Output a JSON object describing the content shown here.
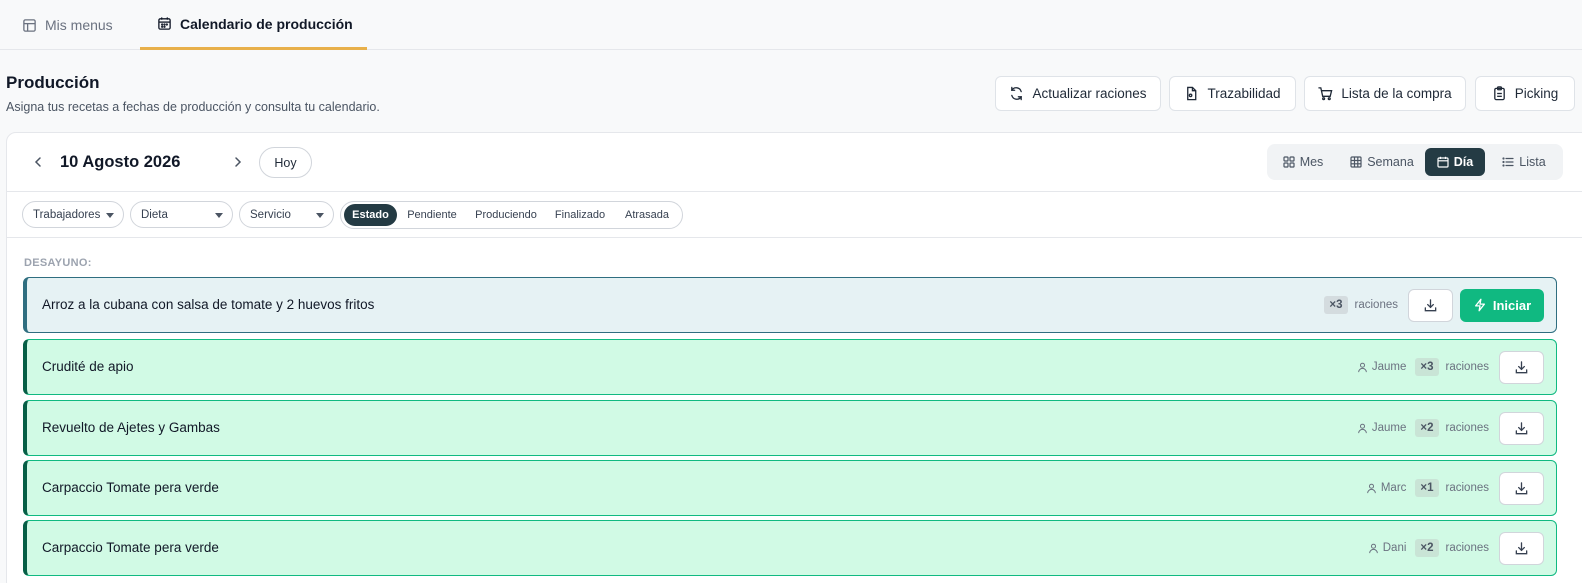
{
  "tabs": [
    {
      "label": "Mis menus",
      "icon": "table-icon"
    },
    {
      "label": "Calendario de producción",
      "icon": "calendar-icon"
    }
  ],
  "page": {
    "title": "Producción",
    "subtitle": "Asigna tus recetas a fechas de producción y consulta tu calendario."
  },
  "actions": [
    {
      "label": "Actualizar raciones",
      "icon": "refresh-icon"
    },
    {
      "label": "Trazabilidad",
      "icon": "document-icon"
    },
    {
      "label": "Lista de la compra",
      "icon": "cart-icon"
    },
    {
      "label": "Picking",
      "icon": "clipboard-icon"
    }
  ],
  "calendar": {
    "date": "10 Agosto 2026",
    "today_label": "Hoy",
    "views": [
      {
        "label": "Mes",
        "icon": "grid-icon"
      },
      {
        "label": "Semana",
        "icon": "table-icon"
      },
      {
        "label": "Día",
        "icon": "calendar-icon",
        "active": true
      },
      {
        "label": "Lista",
        "icon": "list-icon"
      }
    ]
  },
  "filters": {
    "selects": [
      "Trabajadores",
      "Dieta",
      "Servicio"
    ],
    "status": [
      "Estado",
      "Pendiente",
      "Produciendo",
      "Finalizado",
      "Atrasada"
    ],
    "active_status": "Estado"
  },
  "section": {
    "label": "DESAYUNO:",
    "portion_word": "raciones",
    "start_label": "Iniciar",
    "items": [
      {
        "name": "Arroz a la cubana con salsa de tomate y 2 huevos fritos",
        "worker": "",
        "count": "×3",
        "status": "pendiente"
      },
      {
        "name": "Crudité de apio",
        "worker": "Jaume",
        "count": "×3",
        "status": "finalizado"
      },
      {
        "name": "Revuelto de Ajetes y Gambas",
        "worker": "Jaume",
        "count": "×2",
        "status": "finalizado"
      },
      {
        "name": "Carpaccio Tomate pera verde",
        "worker": "Marc",
        "count": "×1",
        "status": "finalizado"
      },
      {
        "name": "Carpaccio Tomate pera verde",
        "worker": "Dani",
        "count": "×2",
        "status": "finalizado"
      }
    ]
  },
  "colors": {
    "accent_tab": "#e8b04a",
    "active_dark": "#243b44",
    "start_green": "#10b981",
    "done_bg": "#d1fae5",
    "pending_bg": "#e6f2f4"
  }
}
